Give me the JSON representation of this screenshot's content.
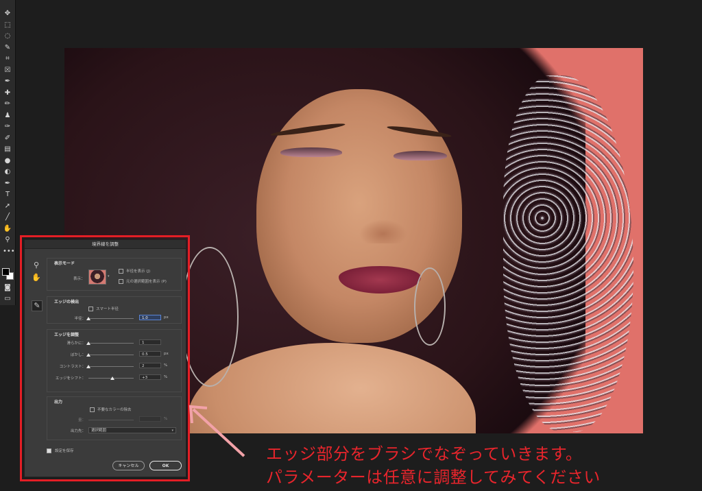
{
  "toolbar": {
    "tools": [
      "move-tool",
      "marquee-tool",
      "lasso-tool",
      "quick-select-tool",
      "crop-tool",
      "frame-tool",
      "eyedropper-tool",
      "healing-tool",
      "brush-tool",
      "stamp-tool",
      "history-brush-tool",
      "eraser-tool",
      "gradient-tool",
      "blur-tool",
      "dodge-tool",
      "pen-tool",
      "type-tool",
      "path-select-tool",
      "line-tool",
      "hand-tool",
      "zoom-tool",
      "more-tools"
    ],
    "glyphs": [
      "✥",
      "⬚",
      "◌",
      "✎",
      "⌗",
      "☒",
      "✒",
      "✚",
      "✏",
      "♟",
      "✑",
      "✐",
      "▤",
      "●",
      "◐",
      "✒",
      "T",
      "➚",
      "╱",
      "✋",
      "⚲",
      "•••"
    ]
  },
  "dialog": {
    "title": "境界線を調整",
    "view_mode": {
      "section_title": "表示モード",
      "view_label": "表示：",
      "show_radius": "半径を表示 (J)",
      "show_original": "元の選択範囲を表示 (P)"
    },
    "edge_detection": {
      "section_title": "エッジの検出",
      "smart_radius": "スマート半径",
      "radius_label": "半径：",
      "radius_value": "1.0",
      "radius_unit": "px",
      "radius_pos": 0.0
    },
    "adjust_edge": {
      "section_title": "エッジを調整",
      "rows": [
        {
          "label": "滑らかに：",
          "value": "1",
          "unit": "",
          "pos": 0.0
        },
        {
          "label": "ぼかし：",
          "value": "0.5",
          "unit": "px",
          "pos": 0.0
        },
        {
          "label": "コントラスト：",
          "value": "2",
          "unit": "%",
          "pos": 0.0
        },
        {
          "label": "エッジをシフト：",
          "value": "+3",
          "unit": "%",
          "pos": 0.53
        }
      ]
    },
    "output": {
      "section_title": "出力",
      "decontaminate": "不要なカラーの除去",
      "amount_label": "量：",
      "amount_unit": "%",
      "output_to_label": "出力先：",
      "output_to_value": "選択範囲"
    },
    "remember": "設定を保存",
    "cancel": "キャンセル",
    "ok": "OK"
  },
  "caption": {
    "line1": "エッジ部分をブラシでなぞっていきます。",
    "line2": "パラメーターは任意に調整してみてください"
  },
  "colors": {
    "accent_red": "#e41e25",
    "caption_red": "#e8252c",
    "background": "#e0716a"
  }
}
